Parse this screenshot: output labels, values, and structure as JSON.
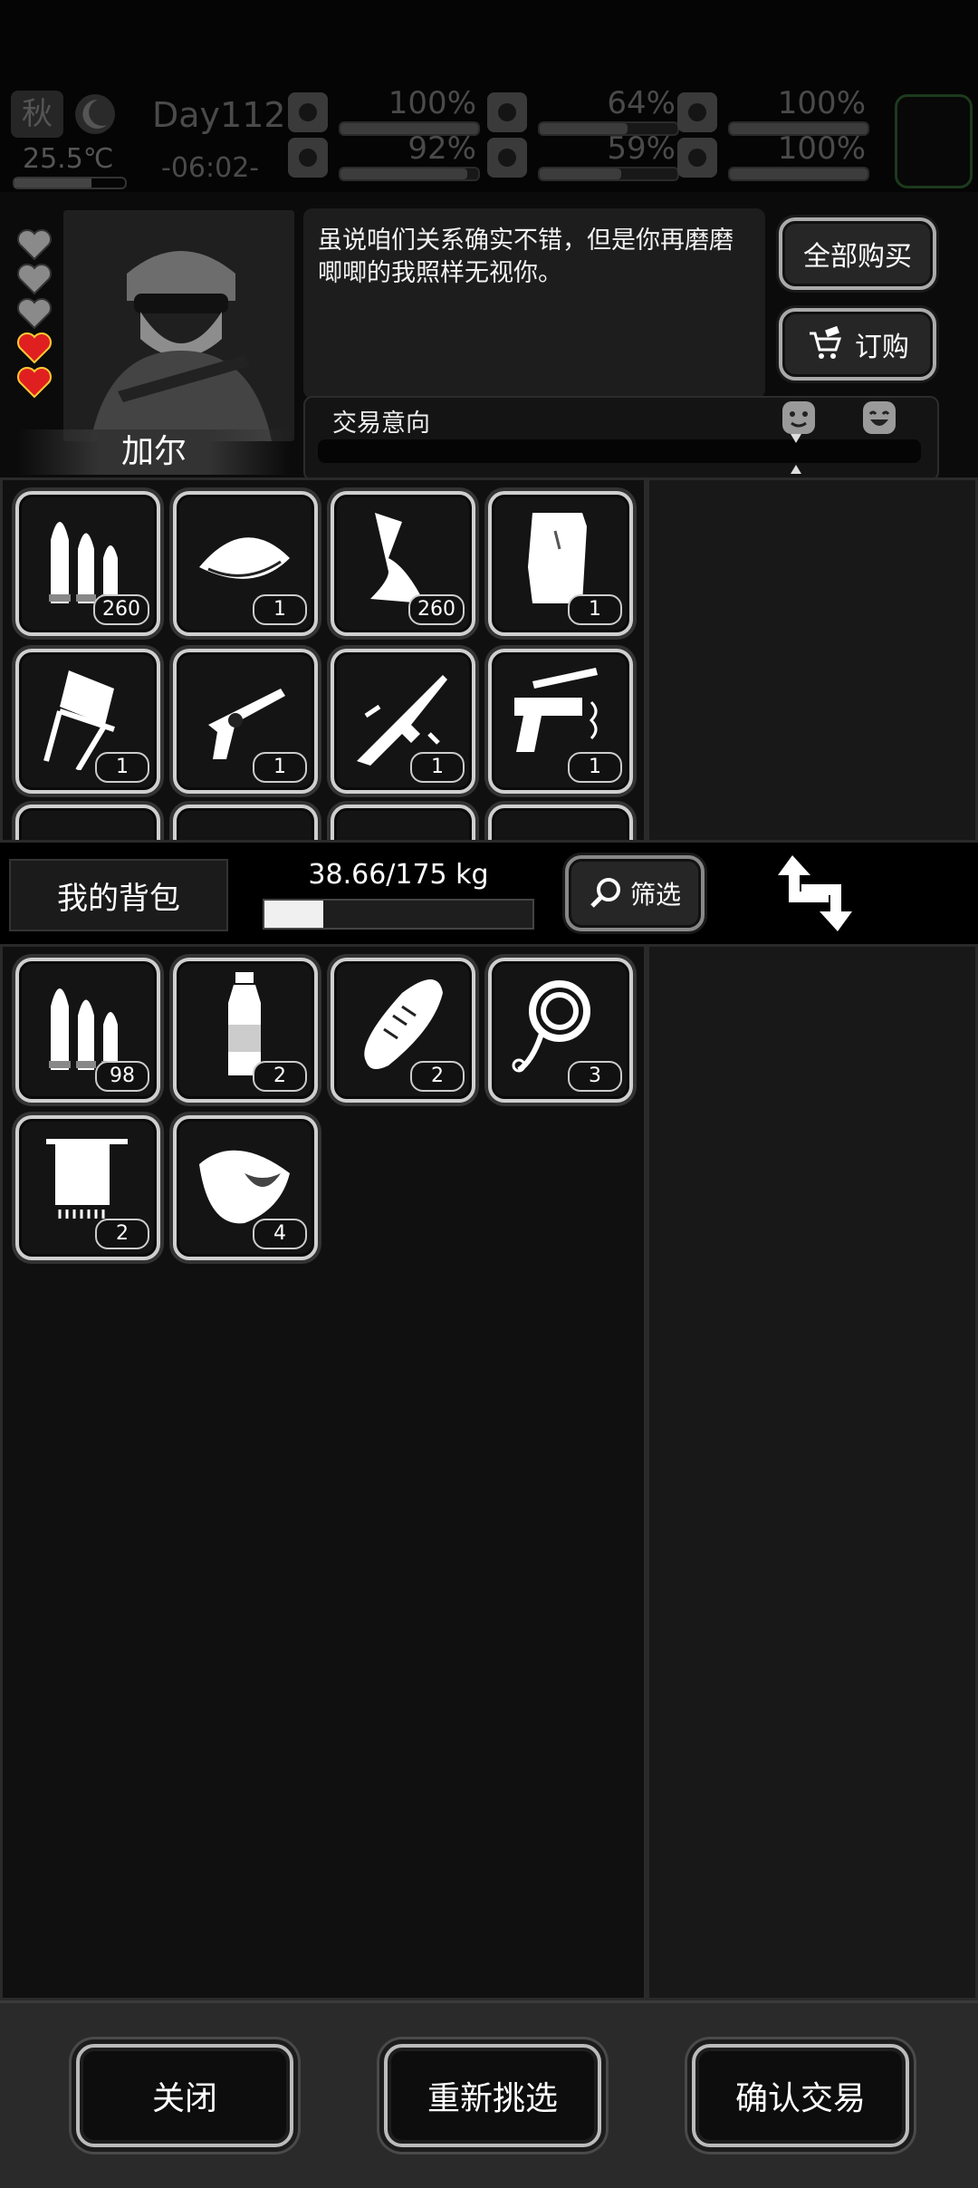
{
  "status": {
    "season": "秋",
    "day": "Day112",
    "temperature": "25.5℃",
    "time": "-06:02-",
    "stats": [
      {
        "name": "health",
        "icon": "medkit-icon",
        "value": "100%",
        "fraction": 1.0
      },
      {
        "name": "hunger",
        "icon": "stomach-icon",
        "value": "64%",
        "fraction": 0.64
      },
      {
        "name": "stamina",
        "icon": "battery-icon",
        "value": "100%",
        "fraction": 1.0
      },
      {
        "name": "mental",
        "icon": "flask-icon",
        "value": "92%",
        "fraction": 0.92
      },
      {
        "name": "thirst",
        "icon": "water-drop-icon",
        "value": "59%",
        "fraction": 0.59
      },
      {
        "name": "mood",
        "icon": "heart-icon",
        "value": "100%",
        "fraction": 1.0
      }
    ]
  },
  "npc": {
    "name": "加尔",
    "hearts_total": 5,
    "hearts_filled": 2,
    "dialog": "虽说咱们关系确实不错，但是你再磨磨唧唧的我照样无视你。",
    "buy_all_label": "全部购买",
    "order_label": "订购",
    "intent_label": "交易意向"
  },
  "trader_items": [
    {
      "icon": "bullets-icon",
      "qty": "260"
    },
    {
      "icon": "saucer-icon",
      "qty": "1"
    },
    {
      "icon": "glue-tube-icon",
      "qty": "260"
    },
    {
      "icon": "paper-icon",
      "qty": "1"
    },
    {
      "icon": "folding-chair-icon",
      "qty": "1"
    },
    {
      "icon": "revolver-icon",
      "qty": "1"
    },
    {
      "icon": "assault-rifle-icon",
      "qty": "1"
    },
    {
      "icon": "pistol-icon",
      "qty": "1"
    }
  ],
  "bag": {
    "title": "我的背包",
    "weight": "38.66/175 kg",
    "weight_fraction": 0.22,
    "filter_label": "筛选"
  },
  "bag_items": [
    {
      "icon": "bullets-icon",
      "qty": "98"
    },
    {
      "icon": "water-bottle-icon",
      "qty": "2"
    },
    {
      "icon": "bread-icon",
      "qty": "2"
    },
    {
      "icon": "rope-icon",
      "qty": "3"
    },
    {
      "icon": "towel-icon",
      "qty": "2"
    },
    {
      "icon": "raw-meat-icon",
      "qty": "4"
    }
  ],
  "actions": {
    "close": "关闭",
    "reselect": "重新挑选",
    "confirm": "确认交易"
  },
  "colors": {
    "heart_filled": "#e02020",
    "heart_empty": "#8a8a8a",
    "frame": "#cfcfcf"
  }
}
